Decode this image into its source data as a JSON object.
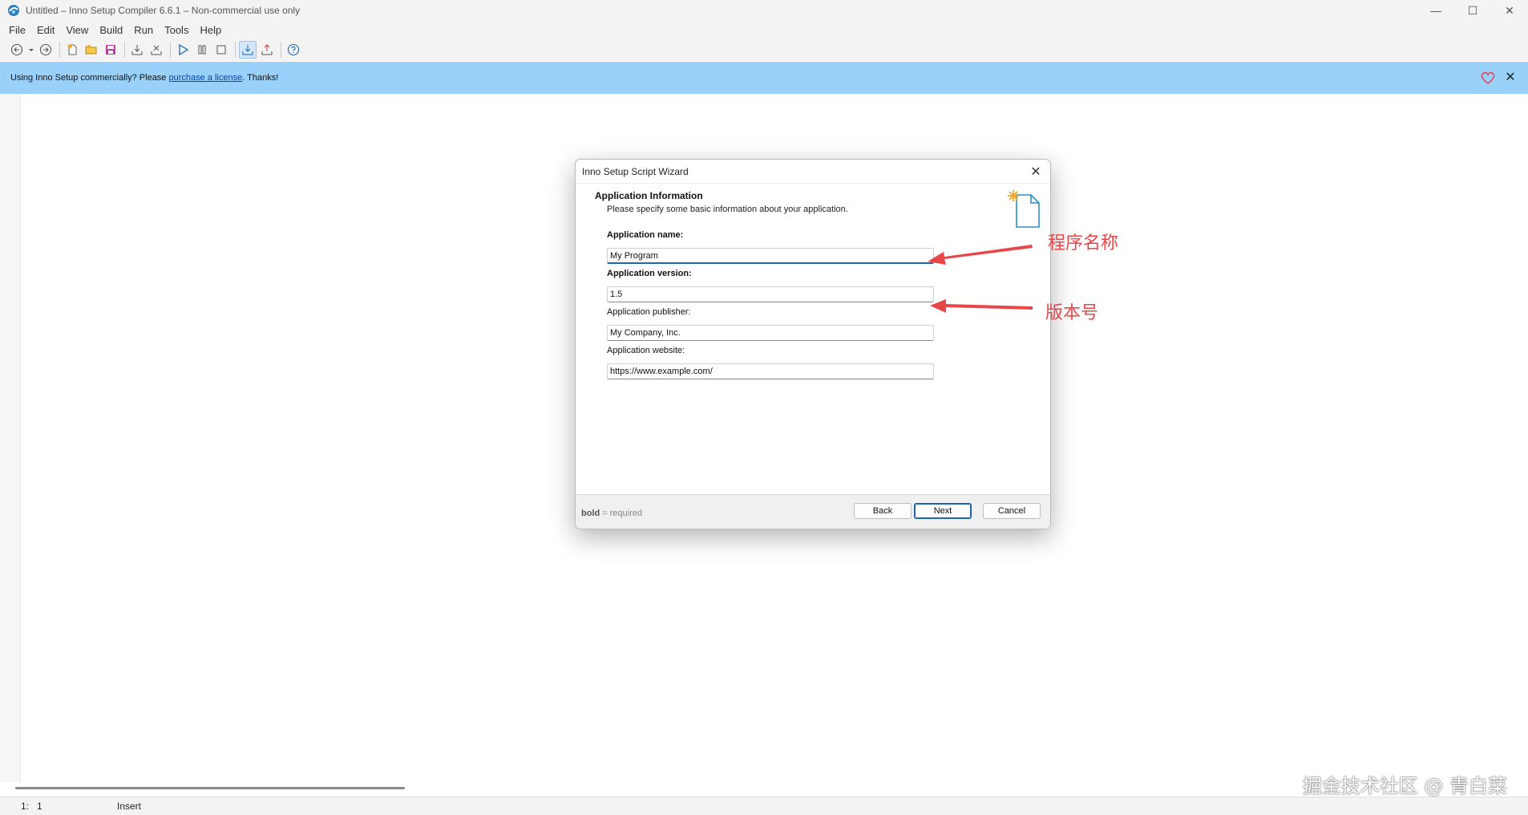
{
  "window": {
    "title": "Untitled – Inno Setup Compiler 6.6.1 – Non-commercial use only",
    "minimize_glyph": "—",
    "maximize_glyph": "☐",
    "close_glyph": "✕"
  },
  "menu": {
    "items": [
      "File",
      "Edit",
      "View",
      "Build",
      "Run",
      "Tools",
      "Help"
    ]
  },
  "toolbar": {
    "icons": [
      "back-icon",
      "dropdown-icon",
      "forward-icon",
      "new-file-icon",
      "open-folder-icon",
      "save-icon",
      "compile-icon",
      "stop-compile-icon",
      "run-icon",
      "pause-icon",
      "stop-icon",
      "target-debug-icon",
      "target-release-icon",
      "help-icon"
    ]
  },
  "banner": {
    "text_before": "Using Inno Setup commercially? Please ",
    "link_text": "purchase a license",
    "text_after": ". Thanks!",
    "close_glyph": "✕"
  },
  "status": {
    "position": "1:   1",
    "mode": "Insert"
  },
  "dialog": {
    "title": "Inno Setup Script Wizard",
    "close_glyph": "✕",
    "header_title": "Application Information",
    "header_subtitle": "Please specify some basic information about your application.",
    "fields": [
      {
        "label": "Application name:",
        "value": "My Program",
        "required": true
      },
      {
        "label": "Application version:",
        "value": "1.5",
        "required": true
      },
      {
        "label": "Application publisher:",
        "value": "My Company, Inc.",
        "required": false
      },
      {
        "label": "Application website:",
        "value": "https://www.example.com/",
        "required": false
      }
    ],
    "footer_bold": "bold",
    "footer_rest": " = required",
    "buttons": {
      "back": "Back",
      "next": "Next",
      "cancel": "Cancel"
    }
  },
  "annotations": {
    "name_label": "程序名称",
    "version_label": "版本号",
    "color": "#e8474a"
  },
  "watermark": "掘金技术社区 @ 青白菜",
  "colors": {
    "banner": "#99d1fb",
    "accent": "#1a65b5"
  }
}
